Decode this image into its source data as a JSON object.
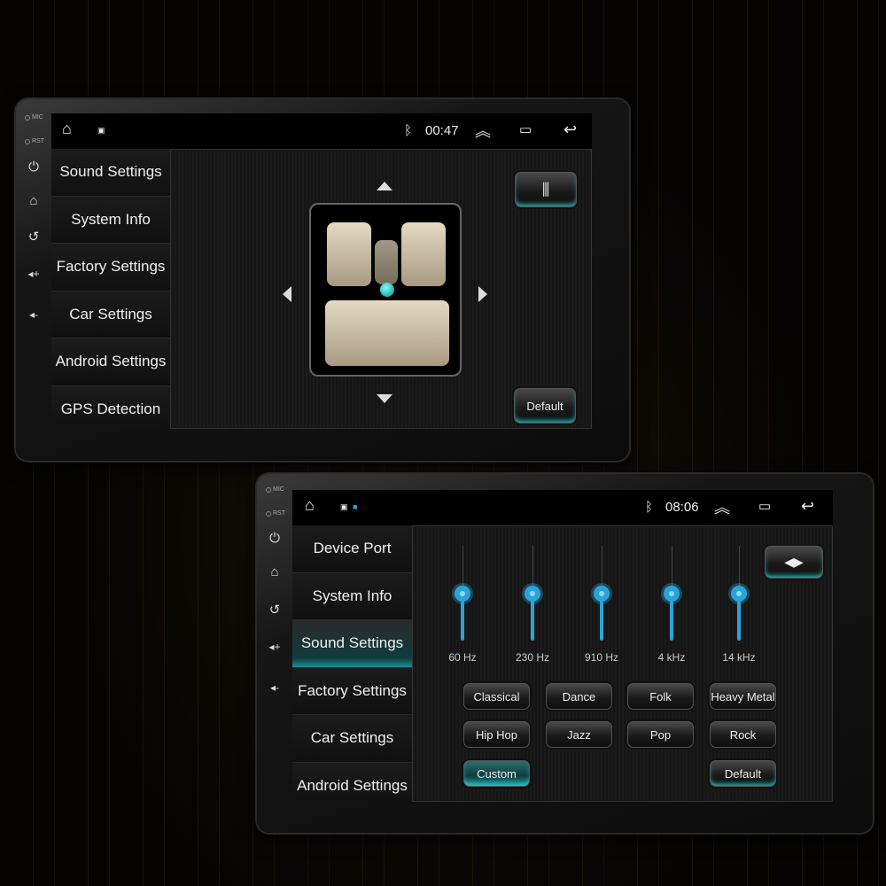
{
  "top_device": {
    "hardware": {
      "mic": "MIC",
      "rst": "RST"
    },
    "status": {
      "time": "00:47"
    },
    "menu": [
      "Sound Settings",
      "System Info",
      "Factory Settings",
      "Car Settings",
      "Android Settings",
      "GPS Detection"
    ],
    "balance": {
      "default_label": "Default"
    }
  },
  "bottom_device": {
    "hardware": {
      "mic": "MIC",
      "rst": "RST"
    },
    "status": {
      "time": "08:06"
    },
    "menu": [
      "Device Port",
      "System Info",
      "Sound Settings",
      "Factory Settings",
      "Car Settings",
      "Android Settings"
    ],
    "active_menu": "Sound Settings",
    "equalizer": {
      "bands": [
        {
          "label": "60 Hz",
          "level": 0.5
        },
        {
          "label": "230 Hz",
          "level": 0.5
        },
        {
          "label": "910 Hz",
          "level": 0.5
        },
        {
          "label": "4 kHz",
          "level": 0.5
        },
        {
          "label": "14 kHz",
          "level": 0.5
        }
      ],
      "presets": [
        "Classical",
        "Dance",
        "Folk",
        "Heavy Metal",
        "Hip Hop",
        "Jazz",
        "Pop",
        "Rock"
      ],
      "custom_label": "Custom",
      "default_label": "Default",
      "selected": "Custom"
    }
  },
  "colors": {
    "accent": "#2aa4d8",
    "glow": "#2cc9c9"
  }
}
